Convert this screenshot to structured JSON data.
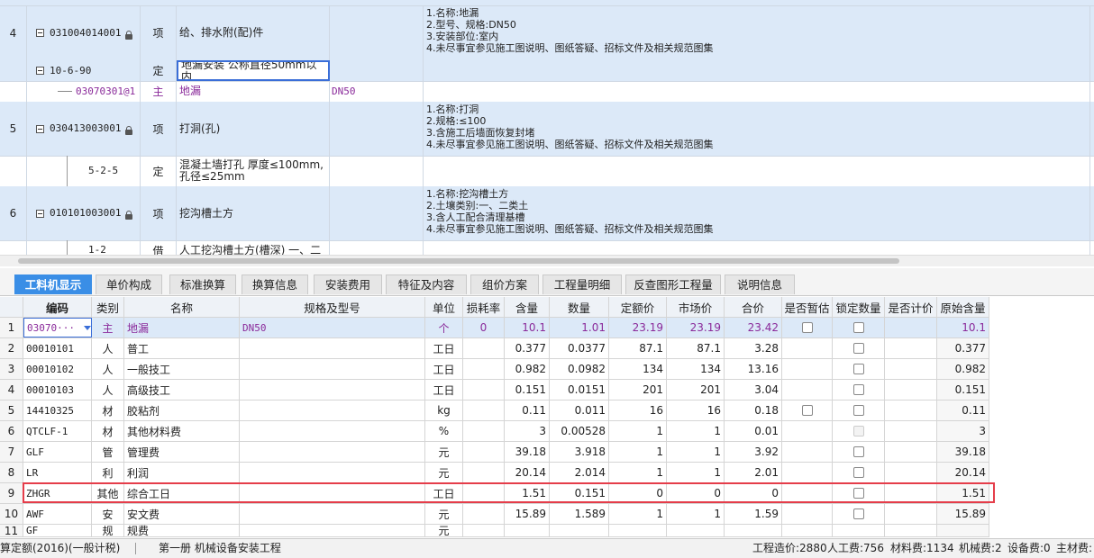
{
  "top_rows": [
    {
      "no": "4",
      "code": "031004014001",
      "type": "项",
      "name": "给、排水附(配)件",
      "spec": "",
      "desc": [
        "1.名称:地漏",
        "2.型号、规格:DN50",
        "3.安装部位:室内",
        "4.未尽事宜参见施工图说明、图纸答疑、招标文件及相关规范图集"
      ]
    },
    {
      "no": "",
      "code": "10-6-90",
      "type": "定",
      "name": "地漏安装 公称直径50mm以内",
      "spec": "",
      "desc": []
    },
    {
      "no": "",
      "code": "03070301@1",
      "type": "主",
      "name": "地漏",
      "spec": "DN50",
      "desc": []
    },
    {
      "no": "5",
      "code": "030413003001",
      "type": "项",
      "name": "打洞(孔)",
      "spec": "",
      "desc": [
        "1.名称:打洞",
        "2.规格:≤100",
        "3.含施工后墙面恢复封堵",
        "4.未尽事宜参见施工图说明、图纸答疑、招标文件及相关规范图集"
      ]
    },
    {
      "no": "",
      "code": "5-2-5",
      "type": "定",
      "name": "混凝土墙打孔 厚度≤100mm,孔径≤25mm",
      "spec": "",
      "desc": []
    },
    {
      "no": "6",
      "code": "010101003001",
      "type": "项",
      "name": "挖沟槽土方",
      "spec": "",
      "desc": [
        "1.名称:挖沟槽土方",
        "2.土壤类别:一、二类土",
        "3.含人工配合清理基槽",
        "4.未尽事宜参见施工图说明、图纸答疑、招标文件及相关规范图集"
      ]
    },
    {
      "no": "",
      "code": "1-2",
      "type": "借",
      "name": "人工挖沟槽土方(槽深) 一、二",
      "spec": "",
      "desc": []
    }
  ],
  "tabs": [
    "工料机显示",
    "单价构成",
    "标准换算",
    "换算信息",
    "安装费用",
    "特征及内容",
    "组价方案",
    "工程量明细",
    "反查图形工程量",
    "说明信息"
  ],
  "grid": {
    "headers": [
      "编码",
      "类别",
      "名称",
      "规格及型号",
      "单位",
      "损耗率",
      "含量",
      "数量",
      "定额价",
      "市场价",
      "合价",
      "是否暂估",
      "锁定数量",
      "是否计价",
      "原始含量"
    ],
    "rows": [
      {
        "no": "1",
        "code": "03070···",
        "cat": "主",
        "name": "地漏",
        "spec": "DN50",
        "unit": "个",
        "loss": "0",
        "qty": "10.1",
        "amount": "1.01",
        "dprice": "23.19",
        "mprice": "23.19",
        "total": "23.42",
        "est": "box",
        "lock": "box",
        "orig": "10.1"
      },
      {
        "no": "2",
        "code": "00010101",
        "cat": "人",
        "name": "普工",
        "spec": "",
        "unit": "工日",
        "loss": "",
        "qty": "0.377",
        "amount": "0.0377",
        "dprice": "87.1",
        "mprice": "87.1",
        "total": "3.28",
        "est": "",
        "lock": "box",
        "orig": "0.377"
      },
      {
        "no": "3",
        "code": "00010102",
        "cat": "人",
        "name": "一般技工",
        "spec": "",
        "unit": "工日",
        "loss": "",
        "qty": "0.982",
        "amount": "0.0982",
        "dprice": "134",
        "mprice": "134",
        "total": "13.16",
        "est": "",
        "lock": "box",
        "orig": "0.982"
      },
      {
        "no": "4",
        "code": "00010103",
        "cat": "人",
        "name": "高级技工",
        "spec": "",
        "unit": "工日",
        "loss": "",
        "qty": "0.151",
        "amount": "0.0151",
        "dprice": "201",
        "mprice": "201",
        "total": "3.04",
        "est": "",
        "lock": "box",
        "orig": "0.151"
      },
      {
        "no": "5",
        "code": "14410325",
        "cat": "材",
        "name": "胶粘剂",
        "spec": "",
        "unit": "kg",
        "loss": "",
        "qty": "0.11",
        "amount": "0.011",
        "dprice": "16",
        "mprice": "16",
        "total": "0.18",
        "est": "box",
        "lock": "box",
        "orig": "0.11"
      },
      {
        "no": "6",
        "code": "QTCLF-1",
        "cat": "材",
        "name": "其他材料费",
        "spec": "",
        "unit": "%",
        "loss": "",
        "qty": "3",
        "amount": "0.00528",
        "dprice": "1",
        "mprice": "1",
        "total": "0.01",
        "est": "",
        "lock": "dis",
        "orig": "3"
      },
      {
        "no": "7",
        "code": "GLF",
        "cat": "管",
        "name": "管理费",
        "spec": "",
        "unit": "元",
        "loss": "",
        "qty": "39.18",
        "amount": "3.918",
        "dprice": "1",
        "mprice": "1",
        "total": "3.92",
        "est": "",
        "lock": "box",
        "orig": "39.18"
      },
      {
        "no": "8",
        "code": "LR",
        "cat": "利",
        "name": "利润",
        "spec": "",
        "unit": "元",
        "loss": "",
        "qty": "20.14",
        "amount": "2.014",
        "dprice": "1",
        "mprice": "1",
        "total": "2.01",
        "est": "",
        "lock": "box",
        "orig": "20.14"
      },
      {
        "no": "9",
        "code": "ZHGR",
        "cat": "其他",
        "name": "综合工日",
        "spec": "",
        "unit": "工日",
        "loss": "",
        "qty": "1.51",
        "amount": "0.151",
        "dprice": "0",
        "mprice": "0",
        "total": "0",
        "est": "",
        "lock": "box",
        "orig": "1.51"
      },
      {
        "no": "10",
        "code": "AWF",
        "cat": "安",
        "name": "安文费",
        "spec": "",
        "unit": "元",
        "loss": "",
        "qty": "15.89",
        "amount": "1.589",
        "dprice": "1",
        "mprice": "1",
        "total": "1.59",
        "est": "",
        "lock": "box",
        "orig": "15.89"
      },
      {
        "no": "11",
        "code": "GF",
        "cat": "规",
        "name": "规费",
        "spec": "",
        "unit": "元",
        "loss": "",
        "qty": "",
        "amount": "",
        "dprice": "",
        "mprice": "",
        "total": "",
        "est": "",
        "lock": "",
        "orig": ""
      }
    ]
  },
  "status": {
    "left": "算定额(2016)(一般计税)",
    "book": "第一册 机械设备安装工程",
    "cost": "工程造价:2880",
    "labor": "人工费:756",
    "material": "材料费:1134",
    "machine": "机械费:2",
    "equipment": "设备费:0",
    "main": "主材费:"
  },
  "colors": {
    "selected_bg": "#dce9f8",
    "tab_active": "#3a8ee6",
    "highlight_box": "#e53d4a",
    "main_material_text": "#8a2a9a"
  }
}
